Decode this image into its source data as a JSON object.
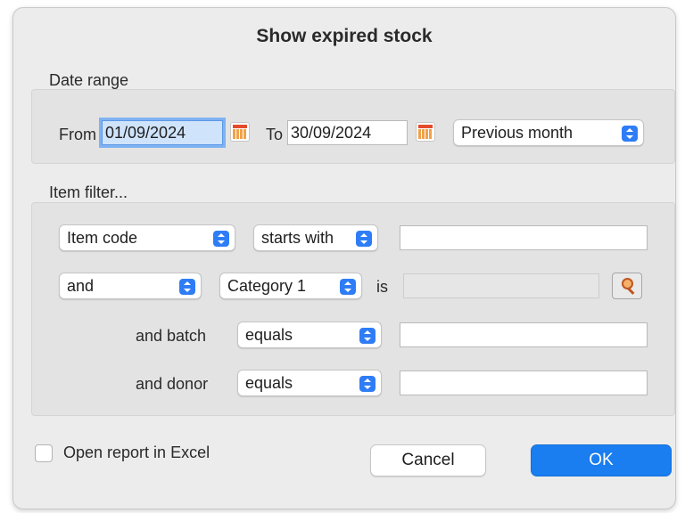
{
  "dialog": {
    "title": "Show expired stock"
  },
  "date_range": {
    "label": "Date range",
    "from_label": "From",
    "from_value": "01/09/2024",
    "to_label": "To",
    "to_value": "30/09/2024",
    "preset": "Previous month"
  },
  "item_filter": {
    "label": "Item filter...",
    "row1": {
      "field": "Item code",
      "operator": "starts with",
      "value": ""
    },
    "row2": {
      "conjunction": "and",
      "field": "Category 1",
      "is_label": "is",
      "value": ""
    },
    "row3": {
      "label": "and batch",
      "operator": "equals",
      "value": ""
    },
    "row4": {
      "label": "and donor",
      "operator": "equals",
      "value": ""
    }
  },
  "footer": {
    "excel_label": "Open report in Excel",
    "excel_checked": false,
    "cancel_label": "Cancel",
    "ok_label": "OK"
  },
  "colors": {
    "accent": "#1a7df0",
    "focus_ring": "#7fb2f2",
    "dialog_bg": "#ececec"
  },
  "icons": {
    "calendar": "calendar-icon",
    "search": "search-icon",
    "popup_arrow": "chevron-updown-icon"
  }
}
